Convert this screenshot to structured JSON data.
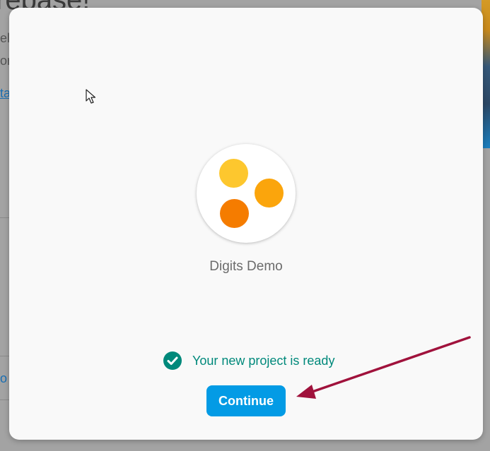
{
  "background": {
    "heading_fragment": "rebase!",
    "line1_fragment": "elo",
    "line2_fragment": "ore",
    "link_fragment": "ta",
    "link2_fragment": "o p"
  },
  "modal": {
    "project_name": "Digits Demo",
    "status_text": "Your new project is ready",
    "continue_label": "Continue"
  },
  "icons": {
    "logo": "project-logo-dots",
    "status": "check-circle-icon",
    "cursor": "mouse-pointer-icon",
    "annotation": "red-arrow-annotation"
  },
  "colors": {
    "accent": "#039be5",
    "status": "#00897b",
    "dot_yellow": "#fdc72e",
    "dot_orange": "#fba50c",
    "dot_dark_orange": "#f57c00",
    "annotation_arrow": "#a0123c"
  }
}
